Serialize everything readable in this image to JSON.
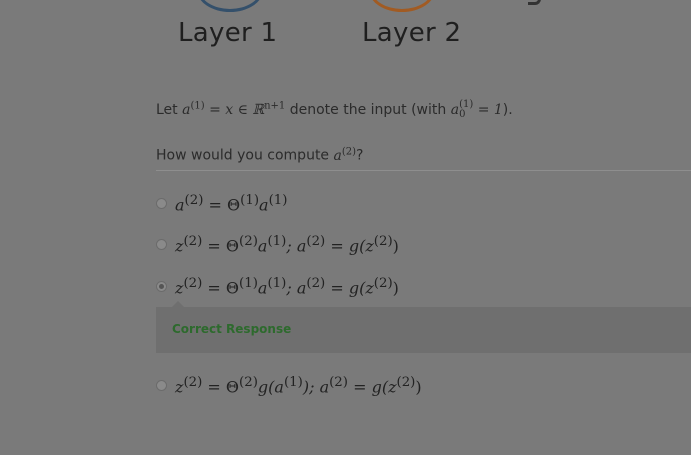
{
  "diagram": {
    "layer1_label": "Layer 1",
    "layer2_label": "Layer 2",
    "layer1_color": "#34506b",
    "layer2_color": "#a15b23"
  },
  "intro": {
    "prefix": "Let ",
    "formula_a": "a",
    "formula_a_sup": "(1)",
    "formula_mid": " = x ∈ ℝ",
    "formula_mid_sup": "n+1",
    "middle_text": " denote the input (with ",
    "formula2_a": "a",
    "formula2_sub": "0",
    "formula2_sup": "(1)",
    "formula2_end": " = 1",
    "suffix": ")."
  },
  "question": {
    "prefix": "How would you compute ",
    "math_a": "a",
    "math_sup": "(2)",
    "suffix": "?"
  },
  "options": [
    {
      "html_parts": [
        "a",
        "(2)",
        " = Θ",
        "(1)",
        "a",
        "(1)"
      ],
      "selected": false
    },
    {
      "html_parts": [
        "z",
        "(2)",
        " = Θ",
        "(2)",
        "a",
        "(1)",
        "; a",
        "(2)",
        " = g(z",
        "(2)",
        ")"
      ],
      "selected": false
    },
    {
      "html_parts": [
        "z",
        "(2)",
        " = Θ",
        "(1)",
        "a",
        "(1)",
        "; a",
        "(2)",
        " = g(z",
        "(2)",
        ")"
      ],
      "selected": true
    },
    {
      "html_parts": [
        "z",
        "(2)",
        " = Θ",
        "(2)",
        "g(a",
        "(1)",
        "); a",
        "(2)",
        " = g(z",
        "(2)",
        ")"
      ],
      "selected": false
    }
  ],
  "feedback": {
    "label": "Correct Response",
    "color": "#2d6a2d"
  }
}
